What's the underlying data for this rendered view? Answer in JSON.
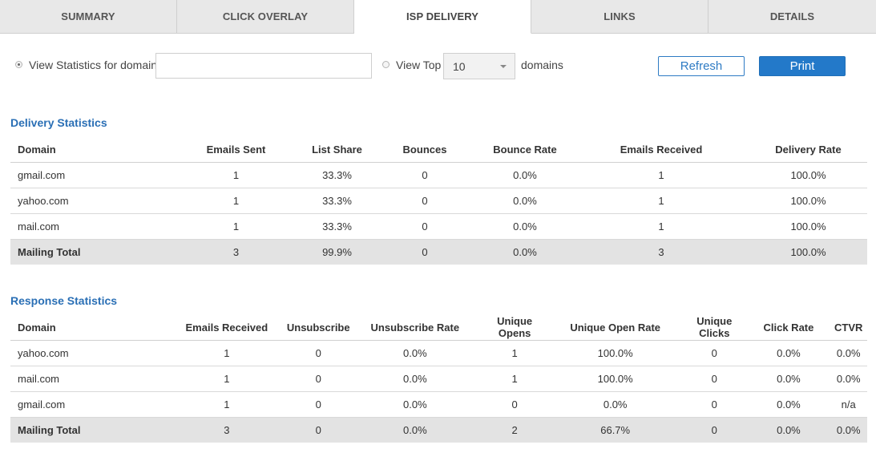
{
  "tabs": [
    {
      "label": "SUMMARY",
      "active": false
    },
    {
      "label": "CLICK OVERLAY",
      "active": false
    },
    {
      "label": "ISP DELIVERY",
      "active": true
    },
    {
      "label": "LINKS",
      "active": false
    },
    {
      "label": "DETAILS",
      "active": false
    }
  ],
  "controls": {
    "view_domain_label": "View Statistics for domain",
    "domain_value": "",
    "view_top_label": "View Top",
    "top_value": "10",
    "domains_label": "domains",
    "refresh_label": "Refresh",
    "print_label": "Print",
    "accent_color": "#2379c9"
  },
  "delivery": {
    "title": "Delivery Statistics",
    "headers": [
      "Domain",
      "Emails Sent",
      "List Share",
      "Bounces",
      "Bounce Rate",
      "Emails Received",
      "Delivery Rate"
    ],
    "rows": [
      [
        "gmail.com",
        "1",
        "33.3%",
        "0",
        "0.0%",
        "1",
        "100.0%"
      ],
      [
        "yahoo.com",
        "1",
        "33.3%",
        "0",
        "0.0%",
        "1",
        "100.0%"
      ],
      [
        "mail.com",
        "1",
        "33.3%",
        "0",
        "0.0%",
        "1",
        "100.0%"
      ]
    ],
    "total": [
      "Mailing Total",
      "3",
      "99.9%",
      "0",
      "0.0%",
      "3",
      "100.0%"
    ]
  },
  "response": {
    "title": "Response Statistics",
    "headers": [
      "Domain",
      "Emails Received",
      "Unsubscribe",
      "Unsubscribe Rate",
      "Unique Opens",
      "Unique Open Rate",
      "Unique Clicks",
      "Click Rate",
      "CTVR"
    ],
    "rows": [
      [
        "yahoo.com",
        "1",
        "0",
        "0.0%",
        "1",
        "100.0%",
        "0",
        "0.0%",
        "0.0%"
      ],
      [
        "mail.com",
        "1",
        "0",
        "0.0%",
        "1",
        "100.0%",
        "0",
        "0.0%",
        "0.0%"
      ],
      [
        "gmail.com",
        "1",
        "0",
        "0.0%",
        "0",
        "0.0%",
        "0",
        "0.0%",
        "n/a"
      ]
    ],
    "total": [
      "Mailing Total",
      "3",
      "0",
      "0.0%",
      "2",
      "66.7%",
      "0",
      "0.0%",
      "0.0%"
    ]
  }
}
